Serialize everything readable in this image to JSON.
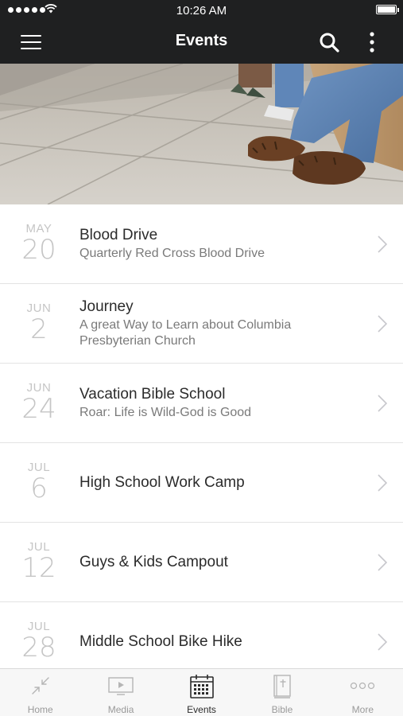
{
  "status_bar": {
    "time": "10:26 AM",
    "battery_level": 1.0
  },
  "nav": {
    "title": "Events"
  },
  "events": [
    {
      "month": "MAY",
      "day": "20",
      "title": "Blood Drive",
      "subtitle": "Quarterly Red Cross Blood Drive"
    },
    {
      "month": "JUN",
      "day": "2",
      "title": "Journey",
      "subtitle": "A great Way to Learn about Columbia Presbyterian Church"
    },
    {
      "month": "JUN",
      "day": "24",
      "title": "Vacation Bible School",
      "subtitle": "Roar: Life is Wild-God is Good"
    },
    {
      "month": "JUL",
      "day": "6",
      "title": "High School Work Camp",
      "subtitle": ""
    },
    {
      "month": "JUL",
      "day": "12",
      "title": "Guys & Kids Campout",
      "subtitle": ""
    },
    {
      "month": "JUL",
      "day": "28",
      "title": "Middle School Bike Hike",
      "subtitle": ""
    }
  ],
  "tabs": [
    {
      "label": "Home",
      "icon": "home-icon",
      "active": false
    },
    {
      "label": "Media",
      "icon": "media-icon",
      "active": false
    },
    {
      "label": "Events",
      "icon": "calendar-icon",
      "active": true
    },
    {
      "label": "Bible",
      "icon": "bible-icon",
      "active": false
    },
    {
      "label": "More",
      "icon": "more-dots-icon",
      "active": false
    }
  ],
  "colors": {
    "bar": "#1f2021",
    "date_text": "#c5c5c5",
    "title_text": "#2b2b2b",
    "subtitle_text": "#7a7a7a",
    "tab_inactive": "#9a9a9a",
    "tab_active": "#2b2b2b"
  }
}
